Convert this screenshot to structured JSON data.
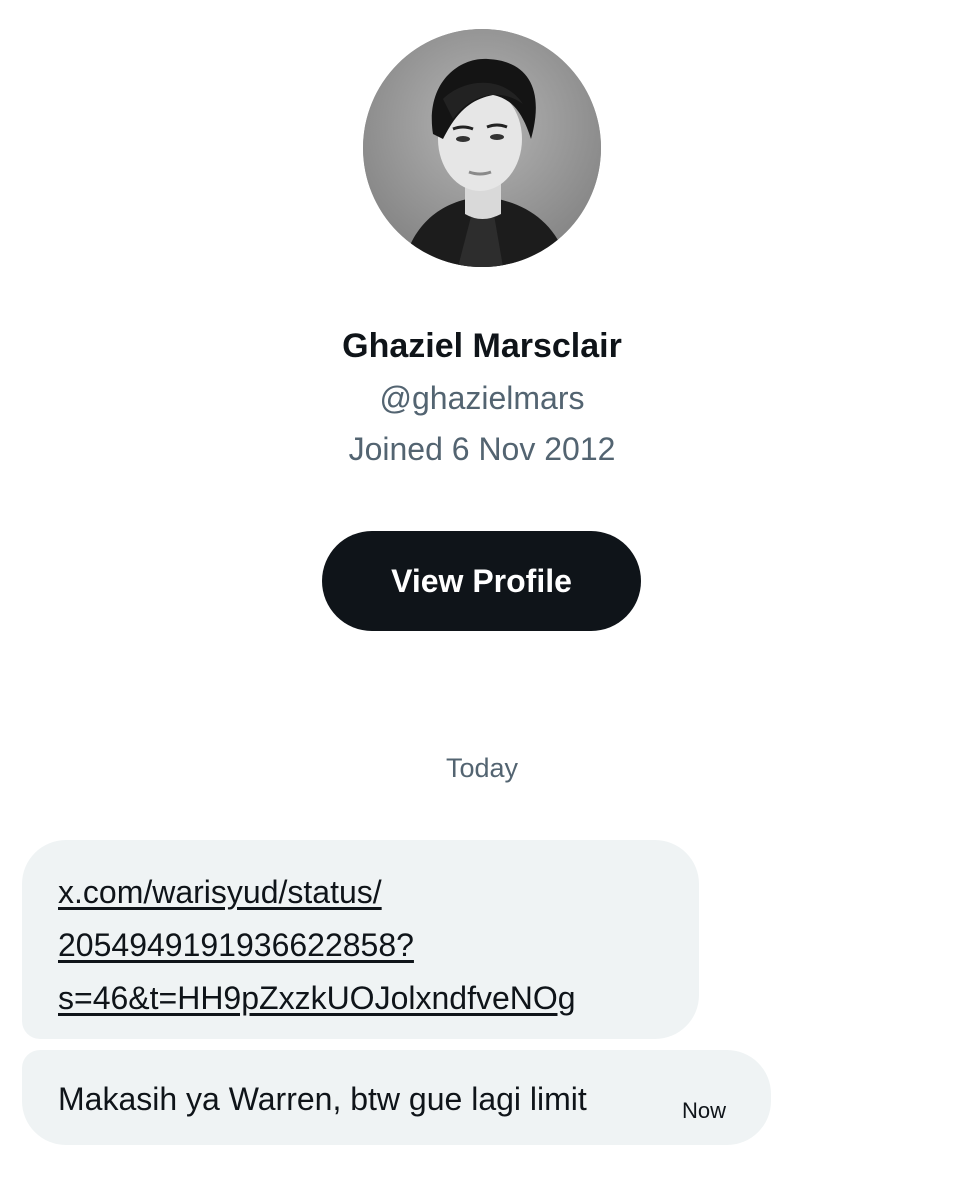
{
  "profile": {
    "display_name": "Ghaziel Marsclair",
    "handle": "@ghazielmars",
    "joined": "Joined 6 Nov 2012",
    "view_profile_label": "View Profile",
    "avatar_icon": "user-avatar-photo"
  },
  "conversation": {
    "date_divider": "Today",
    "messages": [
      {
        "type": "link",
        "text": "x.com/warisyud/status/\n2054949191936622858?\ns=46&t=HH9pZxzkUOJolxndfveNOg"
      },
      {
        "type": "text",
        "text": "Makasih ya Warren, btw gue lagi limit",
        "time": "Now"
      }
    ]
  },
  "colors": {
    "primary_text": "#0f1419",
    "secondary_text": "#536471",
    "bubble_bg": "#eff3f4",
    "button_bg": "#0f1419",
    "button_text": "#ffffff"
  }
}
